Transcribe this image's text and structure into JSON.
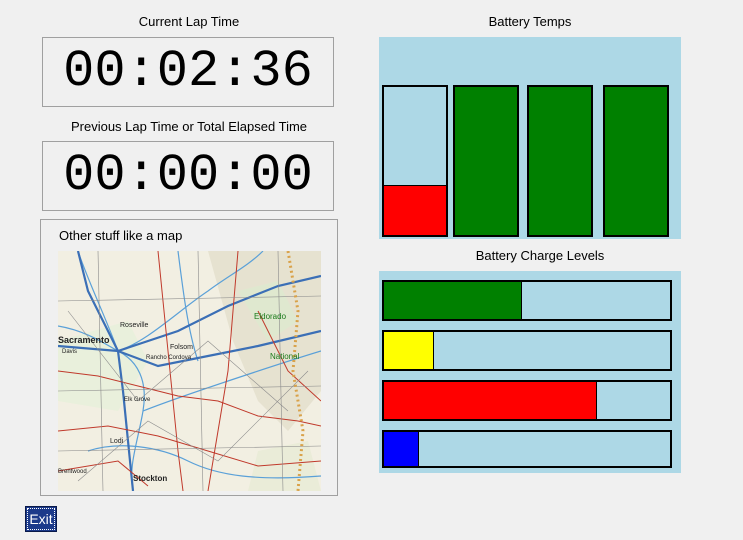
{
  "current_lap": {
    "label": "Current Lap Time",
    "value": "00:02:36"
  },
  "previous_lap": {
    "label": "Previous Lap Time or Total Elapsed Time",
    "value": "00:00:00"
  },
  "map": {
    "label": "Other stuff like a map",
    "place_labels": [
      "Sacramento",
      "Roseville",
      "Folsom",
      "Eldorado",
      "National",
      "Davis",
      "Lodi",
      "Stockton",
      "Elk Grove",
      "Rancho Cordova",
      "Brentwood"
    ]
  },
  "battery_temps": {
    "label": "Battery Temps",
    "cells": [
      {
        "level": 0.33,
        "color": "#ff0000"
      },
      {
        "level": 1.0,
        "color": "#008000"
      },
      {
        "level": 1.0,
        "color": "#008000"
      },
      {
        "level": 1.0,
        "color": "#008000"
      }
    ]
  },
  "battery_charge": {
    "label": "Battery Charge Levels",
    "cells": [
      {
        "level": 0.48,
        "color": "#008000"
      },
      {
        "level": 0.17,
        "color": "#ffff00"
      },
      {
        "level": 0.74,
        "color": "#ff0000"
      },
      {
        "level": 0.12,
        "color": "#0000ff"
      }
    ]
  },
  "exit_button": {
    "label": "Exit"
  }
}
